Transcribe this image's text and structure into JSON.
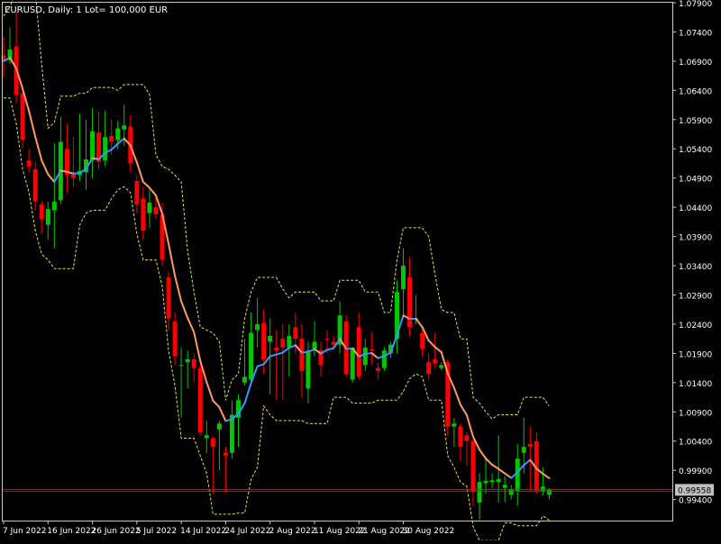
{
  "window": {
    "title": "EURUSD, Daily:  1 Lot= 100,000 EUR"
  },
  "colors": {
    "background": "#000000",
    "frame": "#c8c8c8",
    "bull": "#00c800",
    "bear": "#ff0000",
    "ma_up": "#3399ff",
    "ma_down": "#ff9966",
    "band": "#e6e64d",
    "price_line": "#ff0000",
    "text": "#ffffff",
    "price_label_bg": "#c0c0c0",
    "price_label_text": "#000000"
  },
  "chart_data": {
    "type": "candlestick",
    "symbol": "EURUSD",
    "timeframe": "Daily",
    "current_price": 0.99558,
    "current_price_label": "0.99558",
    "y_tick_labels": [
      "1.07900",
      "1.07400",
      "1.06900",
      "1.06400",
      "1.05900",
      "1.05400",
      "1.04900",
      "1.04400",
      "1.03900",
      "1.03400",
      "1.02900",
      "1.02400",
      "1.01900",
      "1.01400",
      "1.00900",
      "1.00400",
      "0.99900",
      "0.99400"
    ],
    "x_tick_labels": [
      "7 Jun 2022",
      "16 Jun 2022",
      "26 Jun 2022",
      "5 Jul 2022",
      "14 Jul 2022",
      "24 Jul 2022",
      "2 Aug 2022",
      "11 Aug 2022",
      "21 Aug 2022",
      "30 Aug 2022"
    ],
    "ylim": [
      0.9904,
      1.079
    ],
    "indicators": [
      "moving average",
      "envelope bands"
    ],
    "grid": false,
    "candles": [
      {
        "o": 1.07,
        "h": 1.0732,
        "l": 1.0662,
        "c": 1.069
      },
      {
        "o": 1.0692,
        "h": 1.0748,
        "l": 1.0685,
        "c": 1.071
      },
      {
        "o": 1.0715,
        "h": 1.0775,
        "l": 1.0618,
        "c": 1.0632
      },
      {
        "o": 1.0635,
        "h": 1.065,
        "l": 1.054,
        "c": 1.0555
      },
      {
        "o": 1.052,
        "h": 1.054,
        "l": 1.05,
        "c": 1.051
      },
      {
        "o": 1.0505,
        "h": 1.0518,
        "l": 1.0435,
        "c": 1.045
      },
      {
        "o": 1.0445,
        "h": 1.045,
        "l": 1.0395,
        "c": 1.042
      },
      {
        "o": 1.041,
        "h": 1.045,
        "l": 1.0385,
        "c": 1.0437
      },
      {
        "o": 1.0435,
        "h": 1.055,
        "l": 1.037,
        "c": 1.045
      },
      {
        "o": 1.0452,
        "h": 1.0595,
        "l": 1.0445,
        "c": 1.0552
      },
      {
        "o": 1.054,
        "h": 1.0582,
        "l": 1.0465,
        "c": 1.0495
      },
      {
        "o": 1.0497,
        "h": 1.056,
        "l": 1.0475,
        "c": 1.049
      },
      {
        "o": 1.0495,
        "h": 1.06,
        "l": 1.0485,
        "c": 1.0502
      },
      {
        "o": 1.05,
        "h": 1.059,
        "l": 1.047,
        "c": 1.0522
      },
      {
        "o": 1.052,
        "h": 1.061,
        "l": 1.049,
        "c": 1.057
      },
      {
        "o": 1.0568,
        "h": 1.0603,
        "l": 1.0505,
        "c": 1.0518
      },
      {
        "o": 1.052,
        "h": 1.0605,
        "l": 1.051,
        "c": 1.056
      },
      {
        "o": 1.0562,
        "h": 1.059,
        "l": 1.053,
        "c": 1.0552
      },
      {
        "o": 1.0555,
        "h": 1.0588,
        "l": 1.054,
        "c": 1.0575
      },
      {
        "o": 1.0573,
        "h": 1.0615,
        "l": 1.0545,
        "c": 1.058
      },
      {
        "o": 1.0578,
        "h": 1.0598,
        "l": 1.05,
        "c": 1.0515
      },
      {
        "o": 1.0485,
        "h": 1.0495,
        "l": 1.043,
        "c": 1.0445
      },
      {
        "o": 1.0455,
        "h": 1.0475,
        "l": 1.0385,
        "c": 1.04
      },
      {
        "o": 1.043,
        "h": 1.047,
        "l": 1.0405,
        "c": 1.0448
      },
      {
        "o": 1.044,
        "h": 1.046,
        "l": 1.042,
        "c": 1.0428
      },
      {
        "o": 1.0428,
        "h": 1.0448,
        "l": 1.034,
        "c": 1.035
      },
      {
        "o": 1.032,
        "h": 1.033,
        "l": 1.023,
        "c": 1.025
      },
      {
        "o": 1.0245,
        "h": 1.026,
        "l": 1.017,
        "c": 1.0185
      },
      {
        "o": 1.017,
        "h": 1.02,
        "l": 1.008,
        "c": 1.017
      },
      {
        "o": 1.0175,
        "h": 1.0195,
        "l": 1.013,
        "c": 1.018
      },
      {
        "o": 1.018,
        "h": 1.019,
        "l": 1.014,
        "c": 1.0165
      },
      {
        "o": 1.0165,
        "h": 1.0175,
        "l": 1.005,
        "c": 1.0055
      },
      {
        "o": 1.0045,
        "h": 1.0075,
        "l": 1.002,
        "c": 1.005
      },
      {
        "o": 1.0045,
        "h": 1.0048,
        "l": 0.995,
        "c": 1.003
      },
      {
        "o": 1.006,
        "h": 1.0075,
        "l": 0.999,
        "c": 1.007
      },
      {
        "o": 1.002,
        "h": 1.003,
        "l": 0.9952,
        "c": 1.0015
      },
      {
        "o": 1.002,
        "h": 1.011,
        "l": 1.001,
        "c": 1.0085
      },
      {
        "o": 1.008,
        "h": 1.012,
        "l": 1.003,
        "c": 1.011
      },
      {
        "o": 1.014,
        "h": 1.0215,
        "l": 1.0135,
        "c": 1.015
      },
      {
        "o": 1.0145,
        "h": 1.026,
        "l": 1.014,
        "c": 1.0225
      },
      {
        "o": 1.023,
        "h": 1.0285,
        "l": 1.02,
        "c": 1.024
      },
      {
        "o": 1.0242,
        "h": 1.0265,
        "l": 1.0155,
        "c": 1.018
      },
      {
        "o": 1.021,
        "h": 1.025,
        "l": 1.012,
        "c": 1.022
      },
      {
        "o": 1.02,
        "h": 1.023,
        "l": 1.011,
        "c": 1.0195
      },
      {
        "o": 1.0215,
        "h": 1.024,
        "l": 1.011,
        "c": 1.02
      },
      {
        "o": 1.02,
        "h": 1.024,
        "l": 1.015,
        "c": 1.022
      },
      {
        "o": 1.0235,
        "h": 1.026,
        "l": 1.019,
        "c": 1.0215
      },
      {
        "o": 1.0215,
        "h": 1.024,
        "l": 1.0115,
        "c": 1.016
      },
      {
        "o": 1.013,
        "h": 1.021,
        "l": 1.0105,
        "c": 1.0195
      },
      {
        "o": 1.0198,
        "h": 1.0245,
        "l": 1.0185,
        "c": 1.021
      },
      {
        "o": 1.0195,
        "h": 1.021,
        "l": 1.015,
        "c": 1.017
      },
      {
        "o": 1.0215,
        "h": 1.023,
        "l": 1.019,
        "c": 1.0213
      },
      {
        "o": 1.021,
        "h": 1.022,
        "l": 1.0195,
        "c": 1.0205
      },
      {
        "o": 1.0205,
        "h": 1.028,
        "l": 1.019,
        "c": 1.0255
      },
      {
        "o": 1.0245,
        "h": 1.0255,
        "l": 1.015,
        "c": 1.0155
      },
      {
        "o": 1.0145,
        "h": 1.02,
        "l": 1.014,
        "c": 1.02
      },
      {
        "o": 1.0235,
        "h": 1.026,
        "l": 1.0145,
        "c": 1.015
      },
      {
        "o": 1.017,
        "h": 1.0215,
        "l": 1.016,
        "c": 1.02
      },
      {
        "o": 1.0197,
        "h": 1.0225,
        "l": 1.017,
        "c": 1.0195
      },
      {
        "o": 1.0165,
        "h": 1.0175,
        "l": 1.0145,
        "c": 1.016
      },
      {
        "o": 1.0165,
        "h": 1.02,
        "l": 1.016,
        "c": 1.0195
      },
      {
        "o": 1.019,
        "h": 1.021,
        "l": 1.0182,
        "c": 1.0205
      },
      {
        "o": 1.0215,
        "h": 1.0315,
        "l": 1.019,
        "c": 1.0295
      },
      {
        "o": 1.03,
        "h": 1.037,
        "l": 1.025,
        "c": 1.034
      },
      {
        "o": 1.032,
        "h": 1.0355,
        "l": 1.022,
        "c": 1.0235
      },
      {
        "o": 1.025,
        "h": 1.029,
        "l": 1.024,
        "c": 1.025
      },
      {
        "o": 1.0225,
        "h": 1.023,
        "l": 1.0185,
        "c": 1.0198
      },
      {
        "o": 1.0175,
        "h": 1.019,
        "l": 1.0145,
        "c": 1.0155
      },
      {
        "o": 1.018,
        "h": 1.0225,
        "l": 1.0165,
        "c": 1.0173
      },
      {
        "o": 1.0165,
        "h": 1.0175,
        "l": 1.0162,
        "c": 1.017
      },
      {
        "o": 1.0175,
        "h": 1.018,
        "l": 1.005,
        "c": 1.0065
      },
      {
        "o": 1.0065,
        "h": 1.008,
        "l": 1.003,
        "c": 1.007
      },
      {
        "o": 1.0065,
        "h": 1.007,
        "l": 1.0005,
        "c": 1.003
      },
      {
        "o": 1.005,
        "h": 1.0055,
        "l": 0.9998,
        "c": 1.004
      },
      {
        "o": 1.004,
        "h": 1.0043,
        "l": 0.9929,
        "c": 0.9955
      },
      {
        "o": 0.9935,
        "h": 0.9985,
        "l": 0.9905,
        "c": 0.997
      },
      {
        "o": 0.9968,
        "h": 1.0012,
        "l": 0.995,
        "c": 0.9972
      },
      {
        "o": 0.997,
        "h": 0.9985,
        "l": 0.996,
        "c": 0.9973
      },
      {
        "o": 0.997,
        "h": 1.005,
        "l": 0.9935,
        "c": 0.9975
      },
      {
        "o": 0.996,
        "h": 0.998,
        "l": 0.9935,
        "c": 0.9965
      },
      {
        "o": 0.9948,
        "h": 0.9965,
        "l": 0.994,
        "c": 0.9958
      },
      {
        "o": 0.9955,
        "h": 1.0035,
        "l": 0.993,
        "c": 1.001
      },
      {
        "o": 1.002,
        "h": 1.008,
        "l": 0.9985,
        "c": 1.003
      },
      {
        "o": 1.0035,
        "h": 1.0065,
        "l": 0.9955,
        "c": 1.003
      },
      {
        "o": 1.004,
        "h": 1.0055,
        "l": 0.995,
        "c": 0.9955
      },
      {
        "o": 0.9955,
        "h": 0.9995,
        "l": 0.9947,
        "c": 0.9962
      },
      {
        "o": 0.9948,
        "h": 0.996,
        "l": 0.994,
        "c": 0.9958
      }
    ]
  }
}
